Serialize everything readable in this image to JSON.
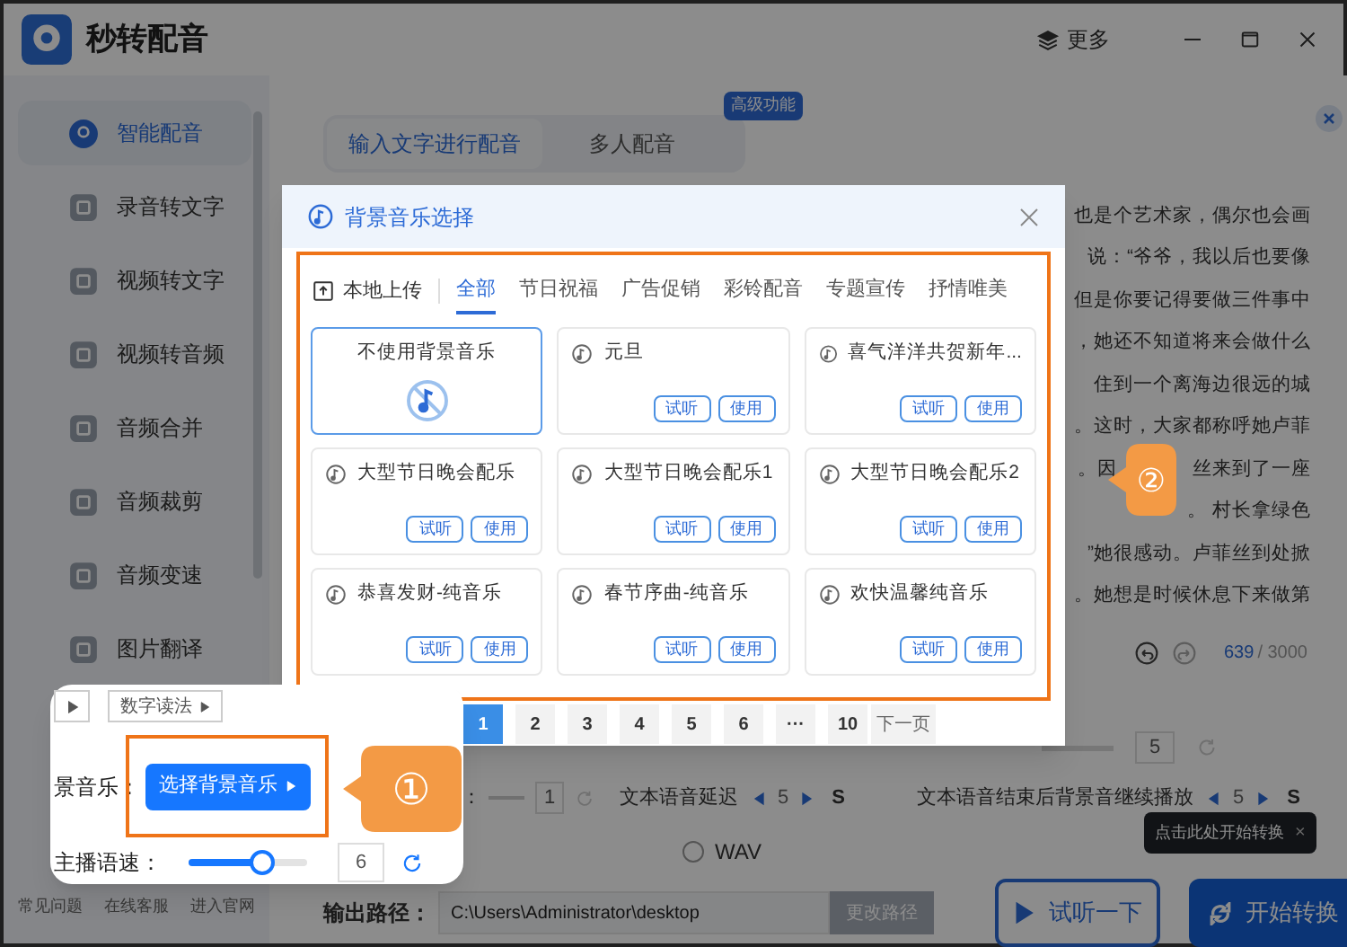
{
  "window": {
    "title": "秒转配音",
    "more": "更多"
  },
  "sidebar": {
    "items": [
      {
        "label": "智能配音",
        "selected": true
      },
      {
        "label": "录音转文字",
        "selected": false
      },
      {
        "label": "视频转文字",
        "selected": false
      },
      {
        "label": "视频转音频",
        "selected": false
      },
      {
        "label": "音频合并",
        "selected": false
      },
      {
        "label": "音频裁剪",
        "selected": false
      },
      {
        "label": "音频变速",
        "selected": false
      },
      {
        "label": "图片翻译",
        "selected": false
      }
    ],
    "footer": [
      "常见问题",
      "在线客服",
      "进入官网"
    ]
  },
  "tabs": [
    {
      "label": "输入文字进行配音",
      "selected": true
    },
    {
      "label": "多人配音",
      "selected": false
    }
  ],
  "tab_badge": "高级功能",
  "text_lines": [
    [
      "也是个艺术家，偶尔也会画"
    ],
    [
      "说：“爷爷，我以后也要像"
    ],
    [
      "但是你要记得要做三件事中"
    ],
    [
      "，她还不知道将来会做什么"
    ],
    [
      "住到一个离海边很远的城"
    ],
    [
      "。这时，大家都称呼她卢菲"
    ],
    [
      "。因",
      "丝来到了一座"
    ],
    [
      "。 村长拿绿色"
    ],
    [
      "”她很感动。卢菲丝到处掀"
    ],
    [
      "。她想是时候休息下来做第"
    ]
  ],
  "counter": {
    "value": "639",
    "max": "/ 3000"
  },
  "speed_box": "5",
  "settings_row": {
    "colon": "：",
    "delay_value": "1",
    "delay_label": "文本语音延迟",
    "delay": {
      "value": "5",
      "unit": "S"
    },
    "continue_label": "文本语音结束后背景音继续播放",
    "continue": {
      "value": "5",
      "unit": "S"
    }
  },
  "format": {
    "label": "WAV",
    "selected": false
  },
  "output": {
    "label": "输出路径：",
    "value": "C:\\Users\\Administrator\\desktop",
    "button": "更改路径"
  },
  "preview_button": "试听一下",
  "start_button": "开始转换",
  "tooltip": {
    "text": "点击此处开始转换",
    "close": "×"
  },
  "modal": {
    "title": "背景音乐选择",
    "upload": "本地上传",
    "categories": [
      {
        "label": "全部",
        "selected": true
      },
      {
        "label": "节日祝福",
        "selected": false
      },
      {
        "label": "广告促销",
        "selected": false
      },
      {
        "label": "彩铃配音",
        "selected": false
      },
      {
        "label": "专题宣传",
        "selected": false
      },
      {
        "label": "抒情唯美",
        "selected": false
      }
    ],
    "cards": [
      {
        "kind": "none",
        "title": "不使用背景音乐",
        "selected": true
      },
      {
        "kind": "track",
        "title": "元旦",
        "selected": false,
        "buttons": [
          "试听",
          "使用"
        ]
      },
      {
        "kind": "track",
        "title": "喜气洋洋共贺新年...",
        "selected": false,
        "buttons": [
          "试听",
          "使用"
        ]
      },
      {
        "kind": "track",
        "title": "大型节日晚会配乐",
        "selected": false,
        "buttons": [
          "试听",
          "使用"
        ]
      },
      {
        "kind": "track",
        "title": "大型节日晚会配乐1",
        "selected": false,
        "buttons": [
          "试听",
          "使用"
        ]
      },
      {
        "kind": "track",
        "title": "大型节日晚会配乐2",
        "selected": false,
        "buttons": [
          "试听",
          "使用"
        ]
      },
      {
        "kind": "track",
        "title": "恭喜发财-纯音乐",
        "selected": false,
        "buttons": [
          "试听",
          "使用"
        ]
      },
      {
        "kind": "track",
        "title": "春节序曲-纯音乐",
        "selected": false,
        "buttons": [
          "试听",
          "使用"
        ]
      },
      {
        "kind": "track",
        "title": "欢快温馨纯音乐",
        "selected": false,
        "buttons": [
          "试听",
          "使用"
        ]
      }
    ],
    "pages": [
      {
        "label": "1",
        "selected": true
      },
      {
        "label": "2",
        "selected": false
      },
      {
        "label": "3",
        "selected": false
      },
      {
        "label": "4",
        "selected": false
      },
      {
        "label": "5",
        "selected": false
      },
      {
        "label": "6",
        "selected": false
      },
      {
        "label": "···",
        "selected": false
      },
      {
        "label": "10",
        "selected": false
      }
    ],
    "next": "下一页"
  },
  "callout_panel": {
    "top_buttons": [
      "数字读法"
    ],
    "bgm_label": "景音乐：",
    "bgm_button": "选择背景音乐",
    "speed_label": "主播语速：",
    "speed": {
      "level": 0.62,
      "value": "6"
    }
  },
  "steps": [
    "①",
    "②"
  ]
}
